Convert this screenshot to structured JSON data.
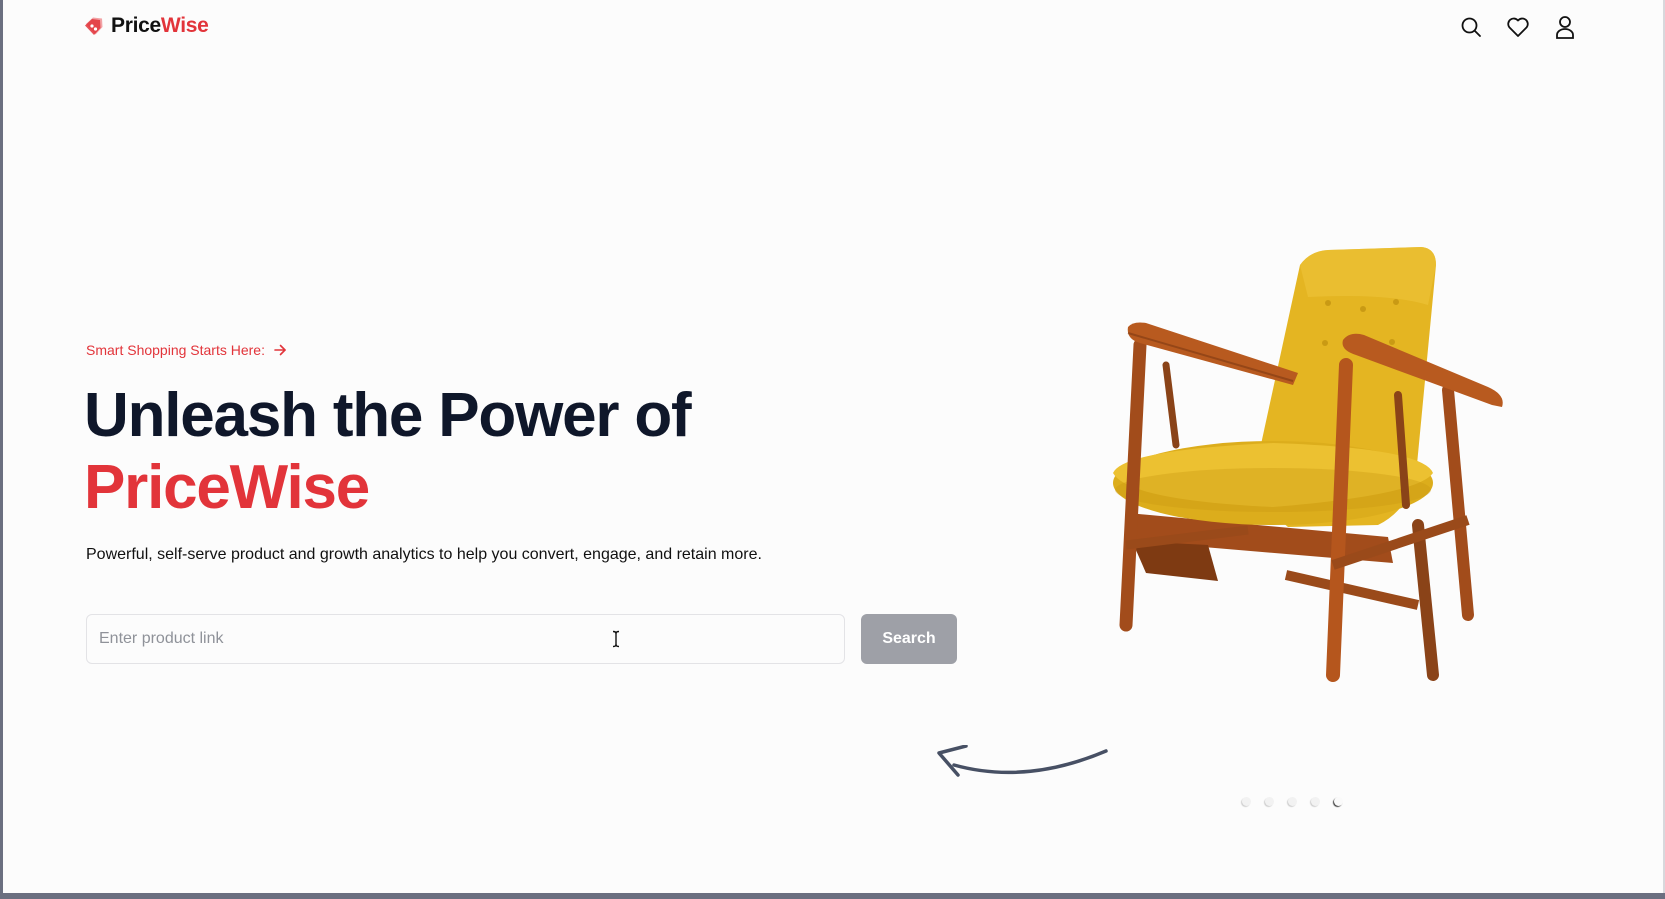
{
  "nav": {
    "logo_prefix": "Price",
    "logo_suffix": "Wise",
    "icons": [
      "search-icon",
      "heart-icon",
      "user-icon"
    ]
  },
  "hero": {
    "tagline": "Smart Shopping Starts Here:",
    "headline_line1": "Unleash the Power of",
    "headline_brand": "PriceWise",
    "subtitle": "Powerful, self-serve product and growth analytics to help you convert, engage, and retain more."
  },
  "search": {
    "placeholder": "Enter product link",
    "value": "",
    "button_label": "Search"
  },
  "carousel": {
    "image": "yellow-armchair",
    "slide_count": 5,
    "active_index": 4
  },
  "colors": {
    "brand": "#e2343a",
    "heading": "#0f172a",
    "button_disabled": "#9ea0a7",
    "background": "#fcfcfc"
  }
}
